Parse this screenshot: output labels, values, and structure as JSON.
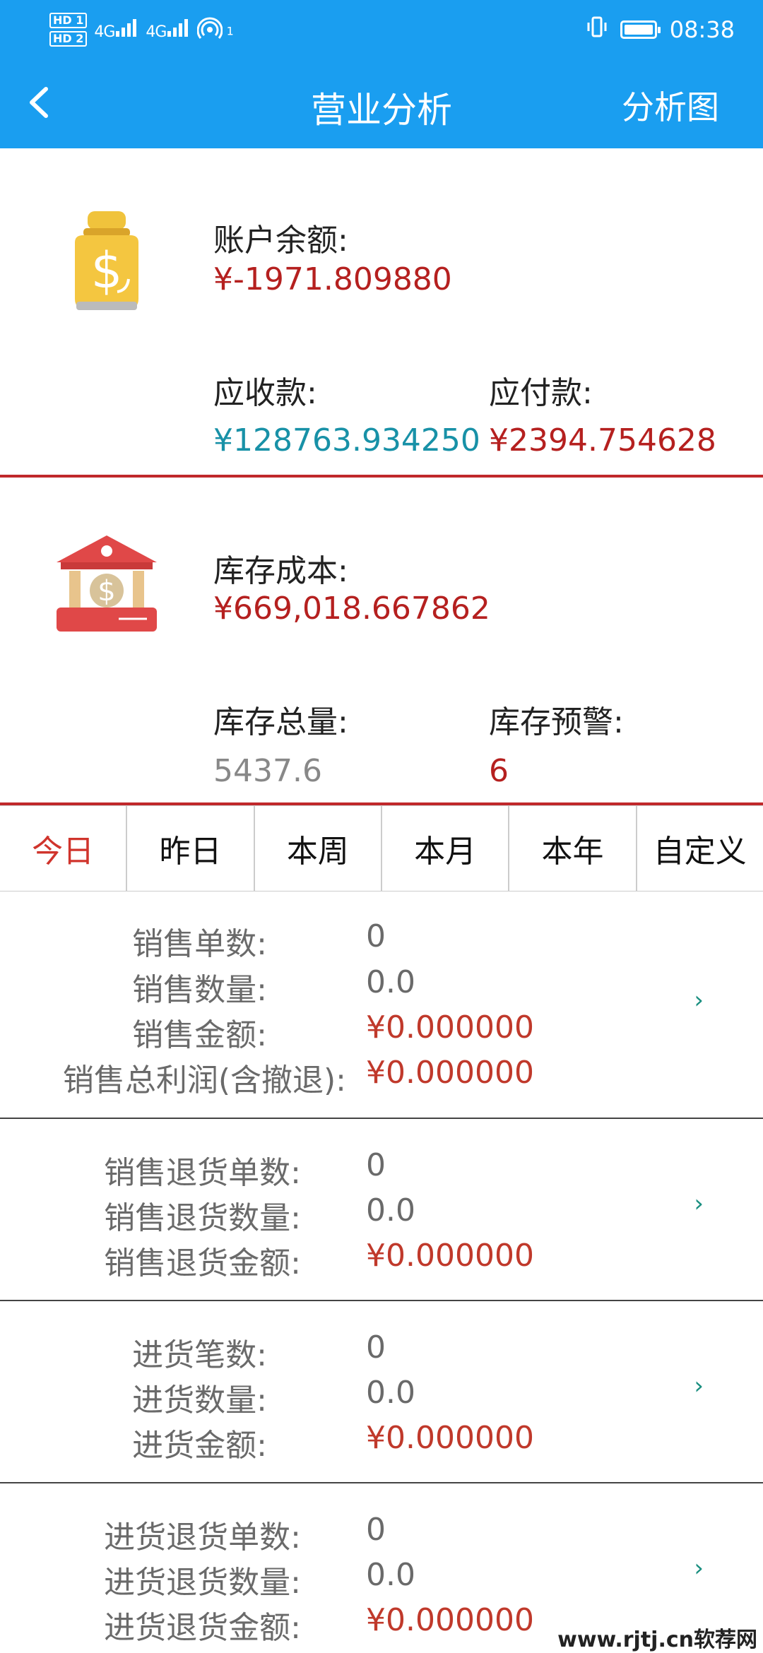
{
  "status_bar": {
    "hd1": "HD 1",
    "hd2": "HD 2",
    "net1": "4G",
    "net2": "4G",
    "wifi_badge": "1",
    "time": "08:38"
  },
  "nav": {
    "back_icon": "back-arrow-icon",
    "title": "营业分析",
    "right_action": "分析图"
  },
  "account": {
    "balance_label": "账户余额:",
    "balance_value": "¥-1971.809880",
    "receivable_label": "应收款:",
    "receivable_value": "¥128763.934250",
    "payable_label": "应付款:",
    "payable_value": "¥2394.754628"
  },
  "inventory": {
    "cost_label": "库存成本:",
    "cost_value": "¥669,018.667862",
    "total_label": "库存总量:",
    "total_value": "5437.6",
    "warning_label": "库存预警:",
    "warning_value": "6"
  },
  "tabs": [
    "今日",
    "昨日",
    "本周",
    "本月",
    "本年",
    "自定义"
  ],
  "active_tab": "今日",
  "stats": {
    "sales": [
      {
        "label": "销售单数:",
        "value": "0"
      },
      {
        "label": "销售数量:",
        "value": "0.0"
      },
      {
        "label": "销售金额:",
        "value": "¥0.000000"
      },
      {
        "label": "销售总利润(含撤退):",
        "value": "¥0.000000"
      }
    ],
    "sales_return": [
      {
        "label": "销售退货单数:",
        "value": "0"
      },
      {
        "label": "销售退货数量:",
        "value": "0.0"
      },
      {
        "label": "销售退货金额:",
        "value": "¥0.000000"
      }
    ],
    "purchase": [
      {
        "label": "进货笔数:",
        "value": "0"
      },
      {
        "label": "进货数量:",
        "value": "0.0"
      },
      {
        "label": "进货金额:",
        "value": "¥0.000000"
      }
    ],
    "purchase_return": [
      {
        "label": "进货退货单数:",
        "value": "0"
      },
      {
        "label": "进货退货数量:",
        "value": "0.0"
      },
      {
        "label": "进货退货金额:",
        "value": "¥0.000000"
      }
    ],
    "chevron": "›"
  },
  "watermark": "www.rjtj.cn软荐网",
  "colors": {
    "primary": "#1a9ef0",
    "red": "#b5201f",
    "teal": "#1891a7",
    "gold": "#f0c33c"
  }
}
